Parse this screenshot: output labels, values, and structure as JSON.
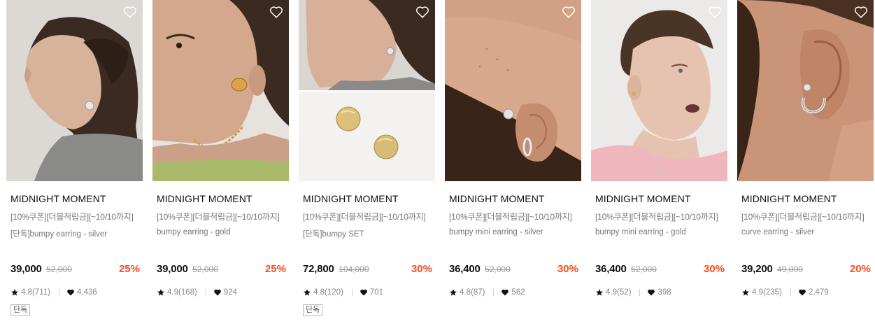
{
  "colors": {
    "discount": "#ff4b1f",
    "text": "#111111",
    "muted": "#777777"
  },
  "products": [
    {
      "brand": "MIDNIGHT MOMENT",
      "promo": "[10%쿠폰][더블적립금][~10/10까지]",
      "name": "[단독]bumpy earring - silver",
      "price": "39,000",
      "original_price": "52,000",
      "discount": "25%",
      "rating": "4.8(711)",
      "likes": "4,436",
      "badge": "단독",
      "icon": "heart-outline-icon"
    },
    {
      "brand": "MIDNIGHT MOMENT",
      "promo": "[10%쿠폰][더블적립금][~10/10까지]",
      "name": "bumpy earring - gold",
      "price": "39,000",
      "original_price": "52,000",
      "discount": "25%",
      "rating": "4.9(168)",
      "likes": "924",
      "badge": "",
      "icon": "heart-outline-icon"
    },
    {
      "brand": "MIDNIGHT MOMENT",
      "promo": "[10%쿠폰][더블적립금][~10/10까지]",
      "name": "[단독]bumpy SET",
      "price": "72,800",
      "original_price": "104,000",
      "discount": "30%",
      "rating": "4.8(120)",
      "likes": "701",
      "badge": "단독",
      "icon": "heart-outline-icon"
    },
    {
      "brand": "MIDNIGHT MOMENT",
      "promo": "[10%쿠폰][더블적립금][~10/10까지]",
      "name": "bumpy mini earring - silver",
      "price": "36,400",
      "original_price": "52,000",
      "discount": "30%",
      "rating": "4.8(87)",
      "likes": "562",
      "badge": "",
      "icon": "heart-outline-icon"
    },
    {
      "brand": "MIDNIGHT MOMENT",
      "promo": "[10%쿠폰][더블적립금][~10/10까지]",
      "name": "bumpy mini earring - gold",
      "price": "36,400",
      "original_price": "52,000",
      "discount": "30%",
      "rating": "4.9(52)",
      "likes": "398",
      "badge": "",
      "icon": "heart-outline-icon"
    },
    {
      "brand": "MIDNIGHT MOMENT",
      "promo": "[10%쿠폰][더블적립금][~10/10까지]",
      "name": "curve earring - silver",
      "price": "39,200",
      "original_price": "49,000",
      "discount": "20%",
      "rating": "4.9(235)",
      "likes": "2,479",
      "badge": "",
      "icon": "heart-outline-icon"
    }
  ]
}
